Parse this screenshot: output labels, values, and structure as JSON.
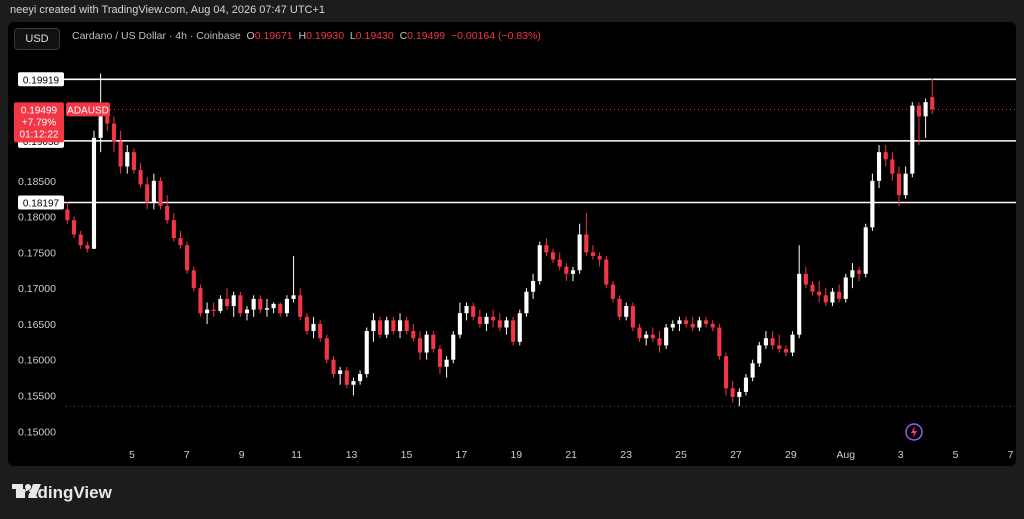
{
  "header": {
    "credit": "neeyi created with TradingView.com, Aug 04, 2026 07:47 UTC+1",
    "currency_button": "USD",
    "symbol_desc": "Cardano / US Dollar · 4h · Coinbase",
    "o_label": "O",
    "o_value": "0.19671",
    "h_label": "H",
    "h_value": "0.19930",
    "l_label": "L",
    "l_value": "0.19430",
    "c_label": "C",
    "c_value": "0.19499",
    "change": "−0.00164 (−0.83%)"
  },
  "price_tag": {
    "price": "0.19499",
    "change_pct": "+7.79%",
    "countdown": "01:12:22",
    "symbol": "ADAUSD"
  },
  "footer": {
    "brand": "TradingView"
  },
  "colors": {
    "up": "#ffffff",
    "down": "#f23645",
    "bg": "#000000",
    "level": "#ffffff"
  },
  "chart_data": {
    "type": "candlestick",
    "ylim": [
      0.1485,
      0.203
    ],
    "yticks": [
      0.15,
      0.155,
      0.16,
      0.165,
      0.17,
      0.175,
      0.18,
      0.185
    ],
    "ytick_labels": [
      "0.15000",
      "0.15500",
      "0.16000",
      "0.16500",
      "0.17000",
      "0.17500",
      "0.18000",
      "0.18500"
    ],
    "xticks": [
      {
        "label": "5",
        "x": 4.8
      },
      {
        "label": "7",
        "x": 6.8
      },
      {
        "label": "9",
        "x": 8.8
      },
      {
        "label": "11",
        "x": 10.8
      },
      {
        "label": "13",
        "x": 12.8
      },
      {
        "label": "15",
        "x": 14.8
      },
      {
        "label": "17",
        "x": 16.8
      },
      {
        "label": "19",
        "x": 18.8
      },
      {
        "label": "21",
        "x": 20.8
      },
      {
        "label": "23",
        "x": 22.8
      },
      {
        "label": "25",
        "x": 24.8
      },
      {
        "label": "27",
        "x": 26.8
      },
      {
        "label": "29",
        "x": 28.8
      },
      {
        "label": "Aug",
        "x": 30.8
      },
      {
        "label": "3",
        "x": 32.8
      },
      {
        "label": "5",
        "x": 34.8
      },
      {
        "label": "7",
        "x": 36.8
      }
    ],
    "xlim": [
      2.4,
      37.0
    ],
    "levels": [
      {
        "value": 0.19919,
        "label": "0.19919"
      },
      {
        "value": 0.19058,
        "label": "0.19058"
      },
      {
        "value": 0.18197,
        "label": "0.18197"
      }
    ],
    "current_price": 0.19499,
    "low_marker": 0.1535,
    "series": [
      [
        0.181,
        0.182,
        0.179,
        0.1795
      ],
      [
        0.1795,
        0.18,
        0.177,
        0.1775
      ],
      [
        0.1775,
        0.178,
        0.1755,
        0.176
      ],
      [
        0.176,
        0.1765,
        0.175,
        0.1755
      ],
      [
        0.1755,
        0.192,
        0.1755,
        0.191
      ],
      [
        0.191,
        0.2,
        0.189,
        0.194
      ],
      [
        0.194,
        0.195,
        0.192,
        0.193
      ],
      [
        0.193,
        0.194,
        0.189,
        0.1905
      ],
      [
        0.1905,
        0.192,
        0.186,
        0.187
      ],
      [
        0.187,
        0.19,
        0.186,
        0.189
      ],
      [
        0.189,
        0.1895,
        0.186,
        0.1865
      ],
      [
        0.1865,
        0.1875,
        0.184,
        0.1845
      ],
      [
        0.1845,
        0.1855,
        0.181,
        0.182
      ],
      [
        0.182,
        0.186,
        0.181,
        0.185
      ],
      [
        0.185,
        0.1855,
        0.181,
        0.1815
      ],
      [
        0.1815,
        0.183,
        0.179,
        0.1795
      ],
      [
        0.1795,
        0.1805,
        0.1765,
        0.177
      ],
      [
        0.177,
        0.178,
        0.1755,
        0.176
      ],
      [
        0.176,
        0.1765,
        0.172,
        0.1725
      ],
      [
        0.1725,
        0.173,
        0.1695,
        0.17
      ],
      [
        0.17,
        0.1705,
        0.166,
        0.1665
      ],
      [
        0.1665,
        0.168,
        0.165,
        0.167
      ],
      [
        0.167,
        0.168,
        0.166,
        0.1668
      ],
      [
        0.1668,
        0.169,
        0.1665,
        0.1685
      ],
      [
        0.1685,
        0.17,
        0.167,
        0.1675
      ],
      [
        0.1675,
        0.1695,
        0.166,
        0.169
      ],
      [
        0.169,
        0.1695,
        0.166,
        0.1665
      ],
      [
        0.1665,
        0.1675,
        0.1655,
        0.167
      ],
      [
        0.167,
        0.169,
        0.166,
        0.1685
      ],
      [
        0.1685,
        0.169,
        0.1665,
        0.167
      ],
      [
        0.167,
        0.1685,
        0.166,
        0.1672
      ],
      [
        0.1672,
        0.168,
        0.1665,
        0.1678
      ],
      [
        0.1678,
        0.168,
        0.166,
        0.1665
      ],
      [
        0.1665,
        0.169,
        0.166,
        0.1685
      ],
      [
        0.1685,
        0.1745,
        0.168,
        0.169
      ],
      [
        0.169,
        0.17,
        0.1655,
        0.166
      ],
      [
        0.166,
        0.1665,
        0.1635,
        0.164
      ],
      [
        0.164,
        0.166,
        0.163,
        0.165
      ],
      [
        0.165,
        0.1655,
        0.1625,
        0.163
      ],
      [
        0.163,
        0.1635,
        0.1595,
        0.16
      ],
      [
        0.16,
        0.1605,
        0.1575,
        0.158
      ],
      [
        0.158,
        0.159,
        0.1565,
        0.1585
      ],
      [
        0.1585,
        0.159,
        0.156,
        0.1565
      ],
      [
        0.1565,
        0.1575,
        0.155,
        0.157
      ],
      [
        0.157,
        0.1585,
        0.1565,
        0.158
      ],
      [
        0.158,
        0.1645,
        0.1575,
        0.164
      ],
      [
        0.164,
        0.1665,
        0.1625,
        0.1655
      ],
      [
        0.1655,
        0.166,
        0.163,
        0.1635
      ],
      [
        0.1635,
        0.166,
        0.163,
        0.1655
      ],
      [
        0.1655,
        0.166,
        0.1635,
        0.164
      ],
      [
        0.164,
        0.1665,
        0.163,
        0.1655
      ],
      [
        0.1655,
        0.166,
        0.1635,
        0.164
      ],
      [
        0.164,
        0.165,
        0.1625,
        0.163
      ],
      [
        0.163,
        0.164,
        0.16,
        0.161
      ],
      [
        0.161,
        0.164,
        0.16,
        0.1635
      ],
      [
        0.1635,
        0.164,
        0.161,
        0.1615
      ],
      [
        0.1615,
        0.162,
        0.158,
        0.159
      ],
      [
        0.159,
        0.1605,
        0.1575,
        0.16
      ],
      [
        0.16,
        0.164,
        0.1595,
        0.1635
      ],
      [
        0.1635,
        0.168,
        0.163,
        0.1665
      ],
      [
        0.1665,
        0.168,
        0.1655,
        0.1675
      ],
      [
        0.1675,
        0.168,
        0.1655,
        0.166
      ],
      [
        0.166,
        0.167,
        0.1645,
        0.165
      ],
      [
        0.165,
        0.1665,
        0.164,
        0.166
      ],
      [
        0.166,
        0.167,
        0.1645,
        0.1655
      ],
      [
        0.1655,
        0.1665,
        0.164,
        0.1645
      ],
      [
        0.1645,
        0.166,
        0.1635,
        0.1655
      ],
      [
        0.1655,
        0.166,
        0.162,
        0.1625
      ],
      [
        0.1625,
        0.167,
        0.162,
        0.1665
      ],
      [
        0.1665,
        0.17,
        0.166,
        0.1695
      ],
      [
        0.1695,
        0.172,
        0.1685,
        0.171
      ],
      [
        0.171,
        0.1765,
        0.1705,
        0.176
      ],
      [
        0.176,
        0.177,
        0.1745,
        0.175
      ],
      [
        0.175,
        0.1755,
        0.1735,
        0.174
      ],
      [
        0.174,
        0.175,
        0.1725,
        0.173
      ],
      [
        0.173,
        0.1735,
        0.171,
        0.172
      ],
      [
        0.172,
        0.173,
        0.171,
        0.1725
      ],
      [
        0.1725,
        0.179,
        0.172,
        0.1775
      ],
      [
        0.1775,
        0.1805,
        0.1745,
        0.175
      ],
      [
        0.175,
        0.176,
        0.174,
        0.1745
      ],
      [
        0.1745,
        0.175,
        0.173,
        0.174
      ],
      [
        0.174,
        0.1745,
        0.17,
        0.1705
      ],
      [
        0.1705,
        0.171,
        0.168,
        0.1685
      ],
      [
        0.1685,
        0.169,
        0.1655,
        0.166
      ],
      [
        0.166,
        0.168,
        0.1655,
        0.1675
      ],
      [
        0.1675,
        0.168,
        0.164,
        0.1645
      ],
      [
        0.1645,
        0.165,
        0.1625,
        0.163
      ],
      [
        0.163,
        0.164,
        0.162,
        0.1635
      ],
      [
        0.1635,
        0.1645,
        0.1625,
        0.163
      ],
      [
        0.163,
        0.164,
        0.161,
        0.162
      ],
      [
        0.162,
        0.165,
        0.1615,
        0.1645
      ],
      [
        0.1645,
        0.1655,
        0.164,
        0.165
      ],
      [
        0.165,
        0.166,
        0.164,
        0.1655
      ],
      [
        0.1655,
        0.166,
        0.1645,
        0.165
      ],
      [
        0.165,
        0.166,
        0.164,
        0.1645
      ],
      [
        0.1645,
        0.166,
        0.164,
        0.1655
      ],
      [
        0.1655,
        0.166,
        0.1645,
        0.165
      ],
      [
        0.165,
        0.1655,
        0.164,
        0.1645
      ],
      [
        0.1645,
        0.165,
        0.16,
        0.1605
      ],
      [
        0.1605,
        0.161,
        0.155,
        0.156
      ],
      [
        0.156,
        0.157,
        0.154,
        0.1548
      ],
      [
        0.1548,
        0.156,
        0.1535,
        0.1555
      ],
      [
        0.1555,
        0.158,
        0.155,
        0.1575
      ],
      [
        0.1575,
        0.16,
        0.157,
        0.1595
      ],
      [
        0.1595,
        0.1625,
        0.159,
        0.162
      ],
      [
        0.162,
        0.164,
        0.1615,
        0.163
      ],
      [
        0.163,
        0.164,
        0.1615,
        0.162
      ],
      [
        0.162,
        0.1635,
        0.161,
        0.1615
      ],
      [
        0.1615,
        0.162,
        0.1605,
        0.161
      ],
      [
        0.161,
        0.164,
        0.1605,
        0.1635
      ],
      [
        0.1635,
        0.176,
        0.163,
        0.172
      ],
      [
        0.172,
        0.173,
        0.17,
        0.1705
      ],
      [
        0.1705,
        0.171,
        0.169,
        0.1695
      ],
      [
        0.1695,
        0.171,
        0.168,
        0.169
      ],
      [
        0.169,
        0.17,
        0.1675,
        0.168
      ],
      [
        0.168,
        0.17,
        0.1675,
        0.1695
      ],
      [
        0.1695,
        0.1705,
        0.168,
        0.1685
      ],
      [
        0.1685,
        0.172,
        0.168,
        0.1715
      ],
      [
        0.1715,
        0.1735,
        0.17,
        0.1725
      ],
      [
        0.1725,
        0.173,
        0.171,
        0.172
      ],
      [
        0.172,
        0.179,
        0.1715,
        0.1785
      ],
      [
        0.1785,
        0.186,
        0.178,
        0.185
      ],
      [
        0.185,
        0.19,
        0.184,
        0.189
      ],
      [
        0.189,
        0.19,
        0.187,
        0.188
      ],
      [
        0.188,
        0.189,
        0.185,
        0.186
      ],
      [
        0.186,
        0.187,
        0.1815,
        0.183
      ],
      [
        0.183,
        0.187,
        0.1825,
        0.186
      ],
      [
        0.186,
        0.196,
        0.1855,
        0.1955
      ],
      [
        0.1955,
        0.196,
        0.19,
        0.194
      ],
      [
        0.194,
        0.1965,
        0.191,
        0.196
      ],
      [
        0.19671,
        0.1993,
        0.1943,
        0.19499
      ]
    ]
  }
}
